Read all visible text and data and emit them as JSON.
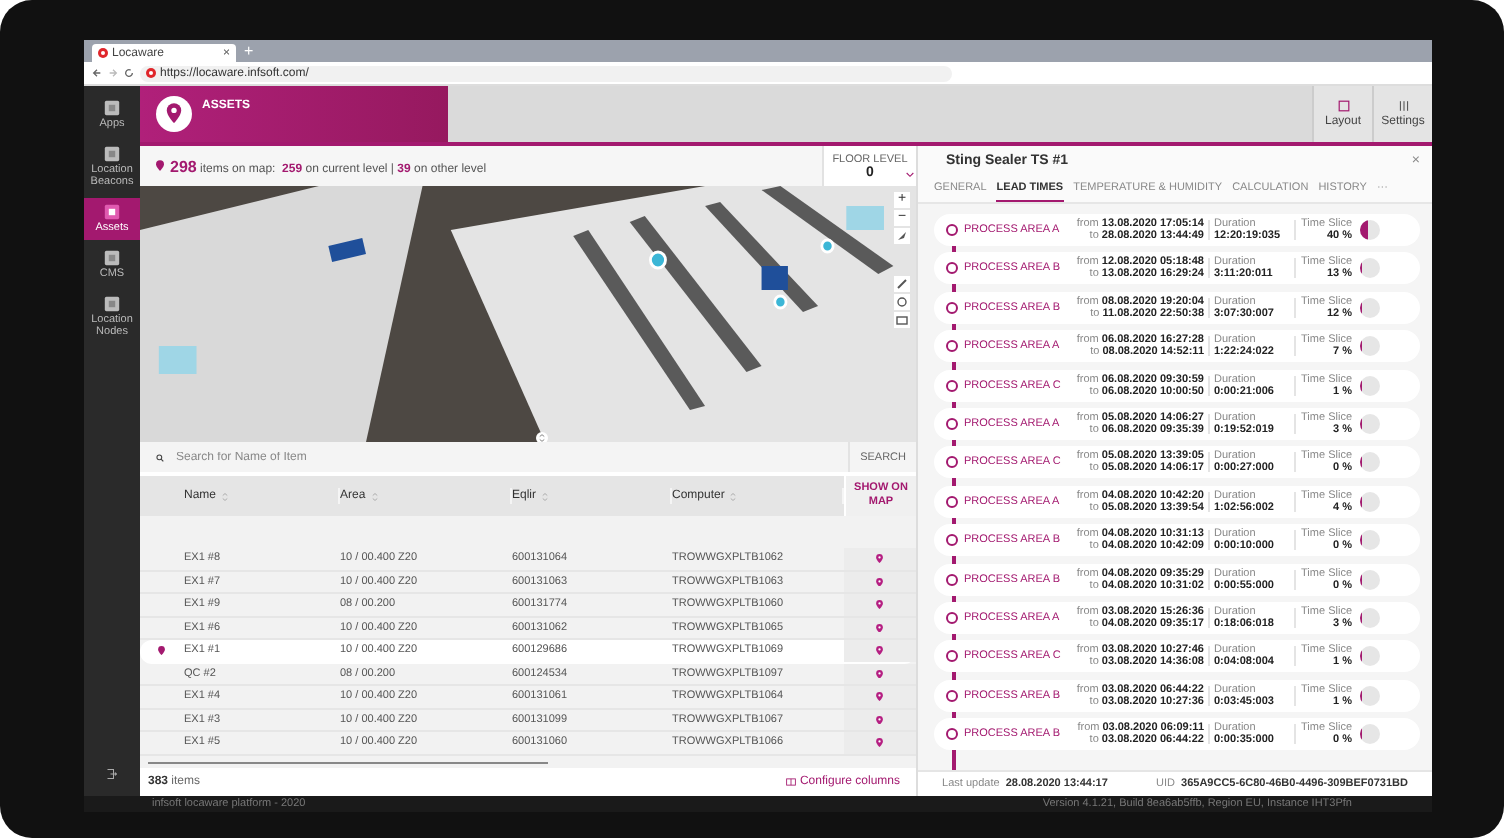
{
  "browser": {
    "tab_title": "Locaware",
    "close_tab": "×",
    "new_tab": "+",
    "url": "https://locaware.infsoft.com/"
  },
  "sidebar": {
    "items": [
      {
        "label": "Apps",
        "selected": false
      },
      {
        "label": "Location Beacons",
        "selected": false
      },
      {
        "label": "Assets",
        "selected": true
      },
      {
        "label": "CMS",
        "selected": false
      },
      {
        "label": "Location Nodes",
        "selected": false
      }
    ]
  },
  "header": {
    "title": "ASSETS",
    "buttons": [
      "Layout",
      "Settings"
    ]
  },
  "summary": {
    "count": "298",
    "count_text": "items on map:",
    "current": "259",
    "current_text": "on current level",
    "separator": "|",
    "other": "39",
    "other_text": "on other level"
  },
  "floor_level": {
    "label": "FLOOR LEVEL",
    "value": "0"
  },
  "map_controls": {
    "zoom_in": "+",
    "zoom_out": "−"
  },
  "search": {
    "placeholder": "Search for Name of Item",
    "button": "SEARCH"
  },
  "table": {
    "columns": [
      "Name",
      "Area",
      "Eqlir",
      "Computer"
    ],
    "action_column": "SHOW ON MAP",
    "rows": [
      {
        "cells": [
          "EX1 #8",
          "10 / 00.400 Z20",
          "600131064",
          "TROWWGXPLTB1062"
        ],
        "selected": false
      },
      {
        "cells": [
          "EX1 #7",
          "10 / 00.400 Z20",
          "600131063",
          "TROWWGXPLTB1063"
        ],
        "selected": false
      },
      {
        "cells": [
          "EX1 #9",
          "08 / 00.200",
          "600131774",
          "TROWWGXPLTB1060"
        ],
        "selected": false
      },
      {
        "cells": [
          "EX1 #6",
          "10 / 00.400 Z20",
          "600131062",
          "TROWWGXPLTB1065"
        ],
        "selected": false
      },
      {
        "cells": [
          "EX1 #1",
          "10 / 00.400 Z20",
          "600129686",
          "TROWWGXPLTB1069"
        ],
        "selected": true
      },
      {
        "cells": [
          "QC #2",
          "08 / 00.200",
          "600124534",
          "TROWWGXPLTB1097"
        ],
        "selected": false
      },
      {
        "cells": [
          "EX1 #4",
          "10 / 00.400 Z20",
          "600131061",
          "TROWWGXPLTB1064"
        ],
        "selected": false
      },
      {
        "cells": [
          "EX1 #3",
          "10 / 00.400 Z20",
          "600131099",
          "TROWWGXPLTB1067"
        ],
        "selected": false
      },
      {
        "cells": [
          "EX1 #5",
          "10 / 00.400 Z20",
          "600131060",
          "TROWWGXPLTB1066"
        ],
        "selected": false
      }
    ]
  },
  "table_footer": {
    "count": "383",
    "count_label": "items",
    "configure": "Configure columns"
  },
  "detail": {
    "title": "Sting Sealer TS #1",
    "close": "×",
    "tabs": [
      {
        "label": "GENERAL",
        "selected": false
      },
      {
        "label": "LEAD TIMES",
        "selected": true
      },
      {
        "label": "TEMPERATURE & HUMIDITY",
        "selected": false
      },
      {
        "label": "CALCULATION",
        "selected": false
      },
      {
        "label": "HISTORY",
        "selected": false
      },
      {
        "label": "···",
        "selected": false
      }
    ],
    "entries": [
      {
        "area": "PROCESS AREA A",
        "from_label": "from",
        "from": "13.08.2020 17:05:14",
        "to_label": "to",
        "to": "28.08.2020 13:44:49",
        "duration_label": "Duration",
        "duration": "12:20:19:035",
        "slice_label": "Time Slice",
        "slice": "40 %",
        "level": 0.4
      },
      {
        "area": "PROCESS AREA B",
        "from_label": "from",
        "from": "12.08.2020 05:18:48",
        "to_label": "to",
        "to": "13.08.2020 16:29:24",
        "duration_label": "Duration",
        "duration": "3:11:20:011",
        "slice_label": "Time Slice",
        "slice": "13 %",
        "level": 0.13
      },
      {
        "area": "PROCESS AREA B",
        "from_label": "from",
        "from": "08.08.2020 19:20:04",
        "to_label": "to",
        "to": "11.08.2020 22:50:38",
        "duration_label": "Duration",
        "duration": "3:07:30:007",
        "slice_label": "Time Slice",
        "slice": "12 %",
        "level": 0.12
      },
      {
        "area": "PROCESS AREA A",
        "from_label": "from",
        "from": "06.08.2020 16:27:28",
        "to_label": "to",
        "to": "08.08.2020 14:52:11",
        "duration_label": "Duration",
        "duration": "1:22:24:022",
        "slice_label": "Time Slice",
        "slice": "7 %",
        "level": 0.07
      },
      {
        "area": "PROCESS AREA C",
        "from_label": "from",
        "from": "06.08.2020 09:30:59",
        "to_label": "to",
        "to": "06.08.2020 10:00:50",
        "duration_label": "Duration",
        "duration": "0:00:21:006",
        "slice_label": "Time Slice",
        "slice": "1 %",
        "level": 0.01
      },
      {
        "area": "PROCESS AREA A",
        "from_label": "from",
        "from": "05.08.2020 14:06:27",
        "to_label": "to",
        "to": "06.08.2020 09:35:39",
        "duration_label": "Duration",
        "duration": "0:19:52:019",
        "slice_label": "Time Slice",
        "slice": "3 %",
        "level": 0.03
      },
      {
        "area": "PROCESS AREA C",
        "from_label": "from",
        "from": "05.08.2020 13:39:05",
        "to_label": "to",
        "to": "05.08.2020 14:06:17",
        "duration_label": "Duration",
        "duration": "0:00:27:000",
        "slice_label": "Time Slice",
        "slice": "0 %",
        "level": 0
      },
      {
        "area": "PROCESS AREA A",
        "from_label": "from",
        "from": "04.08.2020 10:42:20",
        "to_label": "to",
        "to": "05.08.2020 13:39:54",
        "duration_label": "Duration",
        "duration": "1:02:56:002",
        "slice_label": "Time Slice",
        "slice": "4 %",
        "level": 0.04
      },
      {
        "area": "PROCESS AREA B",
        "from_label": "from",
        "from": "04.08.2020 10:31:13",
        "to_label": "to",
        "to": "04.08.2020 10:42:09",
        "duration_label": "Duration",
        "duration": "0:00:10:000",
        "slice_label": "Time Slice",
        "slice": "0 %",
        "level": 0
      },
      {
        "area": "PROCESS AREA B",
        "from_label": "from",
        "from": "04.08.2020 09:35:29",
        "to_label": "to",
        "to": "04.08.2020 10:31:02",
        "duration_label": "Duration",
        "duration": "0:00:55:000",
        "slice_label": "Time Slice",
        "slice": "0 %",
        "level": 0
      },
      {
        "area": "PROCESS AREA A",
        "from_label": "from",
        "from": "03.08.2020 15:26:36",
        "to_label": "to",
        "to": "04.08.2020 09:35:17",
        "duration_label": "Duration",
        "duration": "0:18:06:018",
        "slice_label": "Time Slice",
        "slice": "3 %",
        "level": 0.03
      },
      {
        "area": "PROCESS AREA C",
        "from_label": "from",
        "from": "03.08.2020 10:27:46",
        "to_label": "to",
        "to": "03.08.2020 14:36:08",
        "duration_label": "Duration",
        "duration": "0:04:08:004",
        "slice_label": "Time Slice",
        "slice": "1 %",
        "level": 0.01
      },
      {
        "area": "PROCESS AREA B",
        "from_label": "from",
        "from": "03.08.2020 06:44:22",
        "to_label": "to",
        "to": "03.08.2020 10:27:36",
        "duration_label": "Duration",
        "duration": "0:03:45:003",
        "slice_label": "Time Slice",
        "slice": "1 %",
        "level": 0.01
      },
      {
        "area": "PROCESS AREA B",
        "from_label": "from",
        "from": "03.08.2020 06:09:11",
        "to_label": "to",
        "to": "03.08.2020 06:44:22",
        "duration_label": "Duration",
        "duration": "0:00:35:000",
        "slice_label": "Time Slice",
        "slice": "0 %",
        "level": 0
      }
    ]
  },
  "status": {
    "last_update_label": "Last update",
    "last_update": "28.08.2020 13:44:17",
    "uid_label": "UID",
    "uid": "365A9CC5-6C80-46B0-4496-309BEF0731BD"
  },
  "footer": {
    "left": "infsoft locaware platform - 2020",
    "right": "Version 4.1.21, Build 8ea6ab5ffb, Region EU, Instance IHT3Pfn"
  }
}
